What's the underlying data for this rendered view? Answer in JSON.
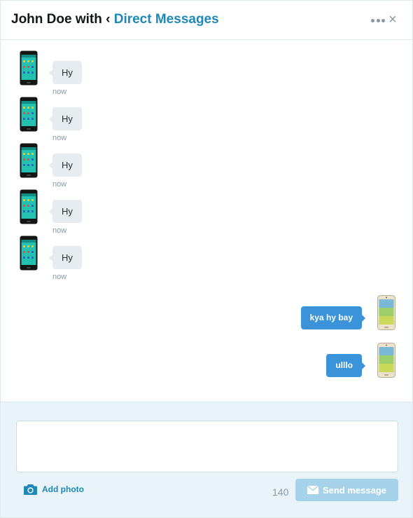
{
  "header": {
    "title_prefix": "John Doe with ‹ ",
    "back_link": "Direct Messages",
    "more_glyph": "•••",
    "close_glyph": "×"
  },
  "conversation": {
    "incoming": [
      {
        "text": "Hy",
        "time": "now",
        "avatar": "smartphone-teal-screen"
      },
      {
        "text": "Hy",
        "time": "now",
        "avatar": "smartphone-teal-screen"
      },
      {
        "text": "Hy",
        "time": "now",
        "avatar": "smartphone-teal-screen"
      },
      {
        "text": "Hy",
        "time": "now",
        "avatar": "smartphone-teal-screen"
      },
      {
        "text": "Hy",
        "time": "now",
        "avatar": "smartphone-teal-screen"
      }
    ],
    "outgoing": [
      {
        "text": "kya hy bay",
        "avatar": "smartphone-gold"
      },
      {
        "text": "ulllo",
        "avatar": "smartphone-gold"
      }
    ]
  },
  "composer": {
    "message_value": "",
    "add_photo_label": "Add photo",
    "char_count": "140",
    "send_label": "Send message",
    "icons": {
      "photo": "camera-icon",
      "send": "envelope-icon"
    }
  },
  "colors": {
    "accent": "#1f88b6",
    "outgoing_bubble": "#3b94d9",
    "incoming_bubble": "#e6ecf0",
    "composer_bg": "#e8f4fa",
    "send_disabled": "#a6d3ea"
  }
}
